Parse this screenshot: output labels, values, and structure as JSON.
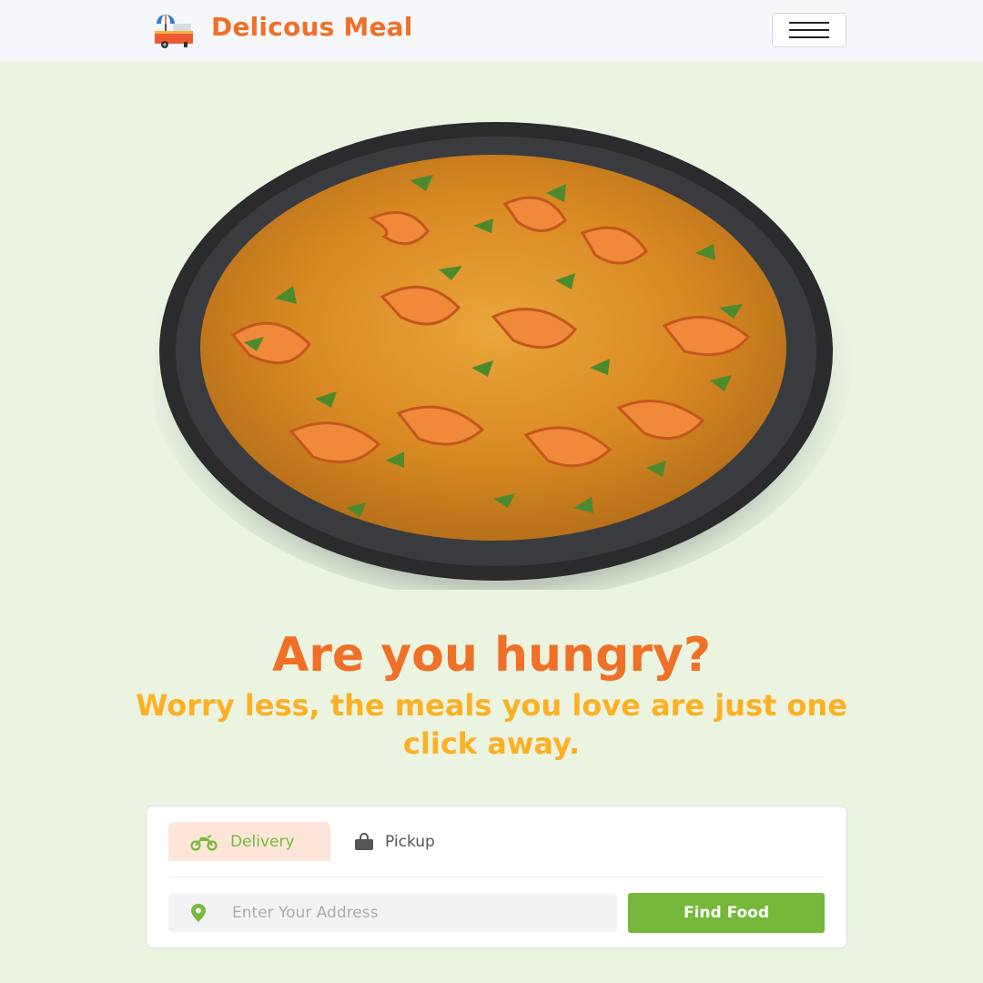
{
  "navbar": {
    "brand_name": "Delicous Meal",
    "logo_icon": "food-cart-icon",
    "menu_icon": "hamburger-menu-icon"
  },
  "hero": {
    "image_description_icon": "shrimp-curry-dish",
    "headline": "Are you hungry?",
    "subheadline": "Worry less, the meals you love are just one click away."
  },
  "search": {
    "tabs": [
      {
        "label": "Delivery",
        "icon": "motorcycle-icon",
        "active": true
      },
      {
        "label": "Pickup",
        "icon": "bag-icon",
        "active": false
      }
    ],
    "address_placeholder": "Enter Your Address",
    "address_value": "",
    "pin_icon": "map-pin-icon",
    "submit_label": "Find Food"
  },
  "colors": {
    "page_background": "#eaf4e0",
    "navbar_background": "#f5f7fa",
    "brand_orange": "#f07027",
    "subheadline_yellow": "#fdb024",
    "accent_green": "#76b83a",
    "active_tab_background": "#fde5d9"
  }
}
